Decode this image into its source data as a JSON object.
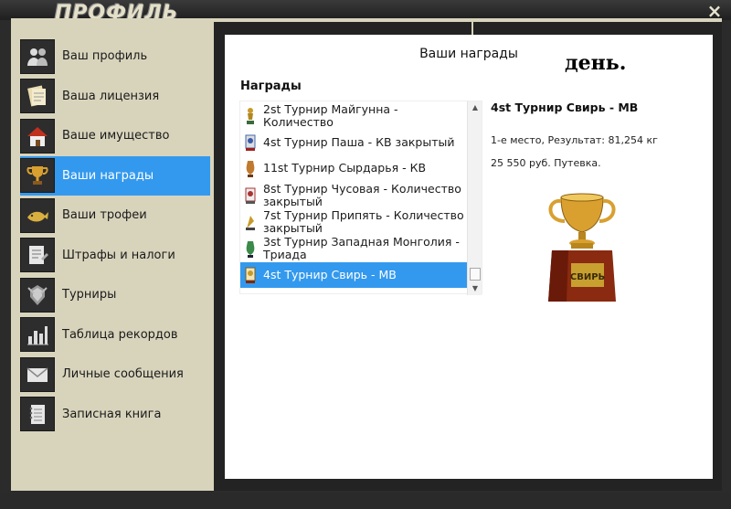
{
  "window": {
    "title": "ПРОФИЛЬ",
    "close_label": "×"
  },
  "sidebar": {
    "items": [
      {
        "label": "Ваш профиль",
        "icon": "users-icon"
      },
      {
        "label": "Ваша лицензия",
        "icon": "license-icon"
      },
      {
        "label": "Ваше имущество",
        "icon": "house-icon"
      },
      {
        "label": "Ваши награды",
        "icon": "trophy-icon",
        "active": true
      },
      {
        "label": "Ваши трофеи",
        "icon": "fish-icon"
      },
      {
        "label": "Штрафы и налоги",
        "icon": "document-icon"
      },
      {
        "label": "Турниры",
        "icon": "tournament-icon"
      },
      {
        "label": "Таблица рекордов",
        "icon": "bar-chart-icon"
      },
      {
        "label": "Личные сообщения",
        "icon": "envelope-icon"
      },
      {
        "label": "Записная книга",
        "icon": "notebook-icon"
      }
    ]
  },
  "panel": {
    "title": "Ваши награды",
    "day_text": "день.",
    "awards_heading": "Награды",
    "awards": [
      {
        "label": "2st Турнир Майгунна - Количество",
        "icon": "statuette-icon"
      },
      {
        "label": "4st Турнир Паша - КВ закрытый",
        "icon": "medal-icon"
      },
      {
        "label": "11st Турнир Сырдарья - КВ",
        "icon": "vase-icon"
      },
      {
        "label": "8st Турнир Чусовая - Количество закрытый",
        "icon": "medal-icon"
      },
      {
        "label": "7st Турнир Припять - Количество закрытый",
        "icon": "statuette-icon"
      },
      {
        "label": "3st Турнир Западная Монголия - Триада",
        "icon": "vase-icon"
      },
      {
        "label": "4st Турнир Свирь - МВ",
        "icon": "medal-icon",
        "selected": true
      }
    ],
    "scroll_up": "▲",
    "scroll_down": "▼",
    "detail": {
      "title": "4st Турнир Свирь - МВ",
      "result": "1-е место, Результат: 81,254 кг",
      "prize": "25 550 руб. Путевка.",
      "trophy_plaque": "СВИРЬ"
    }
  },
  "colors": {
    "accent": "#3399ee",
    "frame_dark": "#2b2b2b",
    "sidebar_bg": "#d8d4bc",
    "trophy_gold": "#d9a030",
    "trophy_base": "#8a2a10"
  }
}
